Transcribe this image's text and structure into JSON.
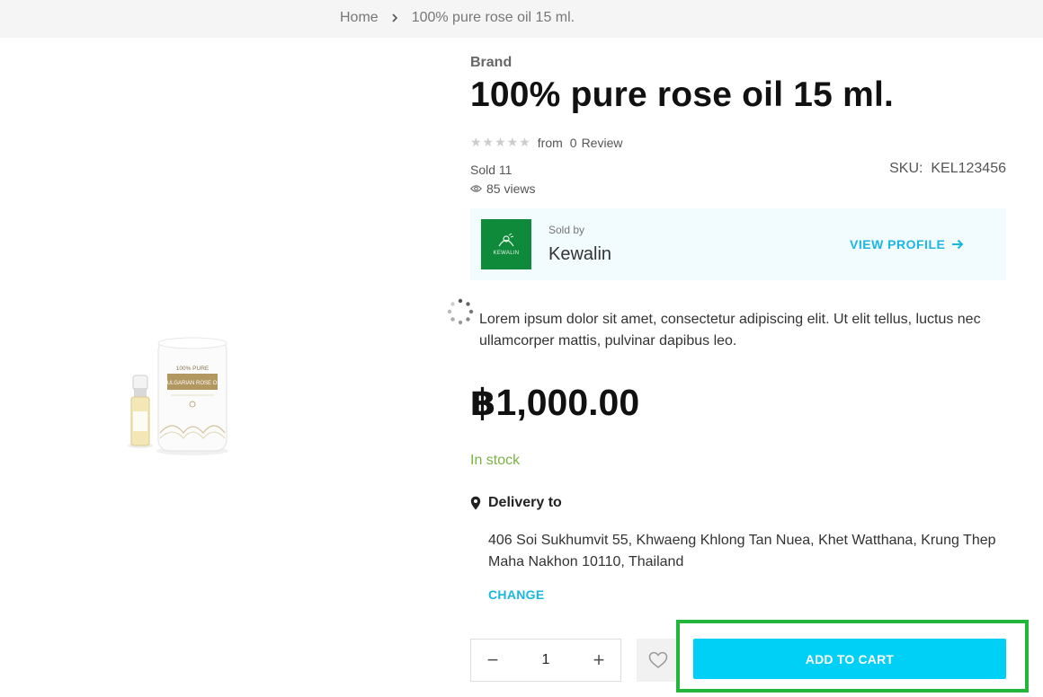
{
  "breadcrumb": {
    "home": "Home",
    "current": "100% pure rose oil 15 ml."
  },
  "product": {
    "brand": "Brand",
    "title": "100% pure rose oil 15 ml.",
    "rating_stars": "★★★★★",
    "rating_from": "from",
    "review_count": "0",
    "review_label": "Review",
    "sold": "Sold 11",
    "views": "85 views",
    "sku_label": "SKU:",
    "sku_value": "KEL123456",
    "description": "Lorem ipsum dolor sit amet, consectetur adipiscing elit. Ut elit tellus, luctus nec ullamcorper mattis, pulvinar dapibus leo.",
    "price": "฿1,000.00",
    "stock_status": "In stock",
    "image_text_top": "100% PURE",
    "image_text_band": "BULGARIAN ROSE OIL"
  },
  "seller": {
    "sold_by_label": "Sold by",
    "name": "Kewalin",
    "logo_text": "KEWALIN",
    "view_profile": "VIEW PROFILE"
  },
  "delivery": {
    "label": "Delivery to",
    "address": "406 Soi Sukhumvit 55, Khwaeng Khlong Tan Nuea, Khet Watthana, Krung Thep Maha Nakhon 10110, Thailand",
    "change": "CHANGE"
  },
  "cart": {
    "minus": "−",
    "quantity": "1",
    "plus": "+",
    "add_to_cart": "ADD TO CART"
  },
  "colors": {
    "accent": "#1ab7e0",
    "button": "#00d0f5",
    "stock": "#7cb342",
    "highlight": "#22b73a",
    "seller_logo": "#0e8a3a"
  },
  "icons": [
    "chevron-right-icon",
    "star-icon",
    "eye-icon",
    "arrow-right-icon",
    "map-pin-icon",
    "heart-icon",
    "spinner-icon"
  ]
}
